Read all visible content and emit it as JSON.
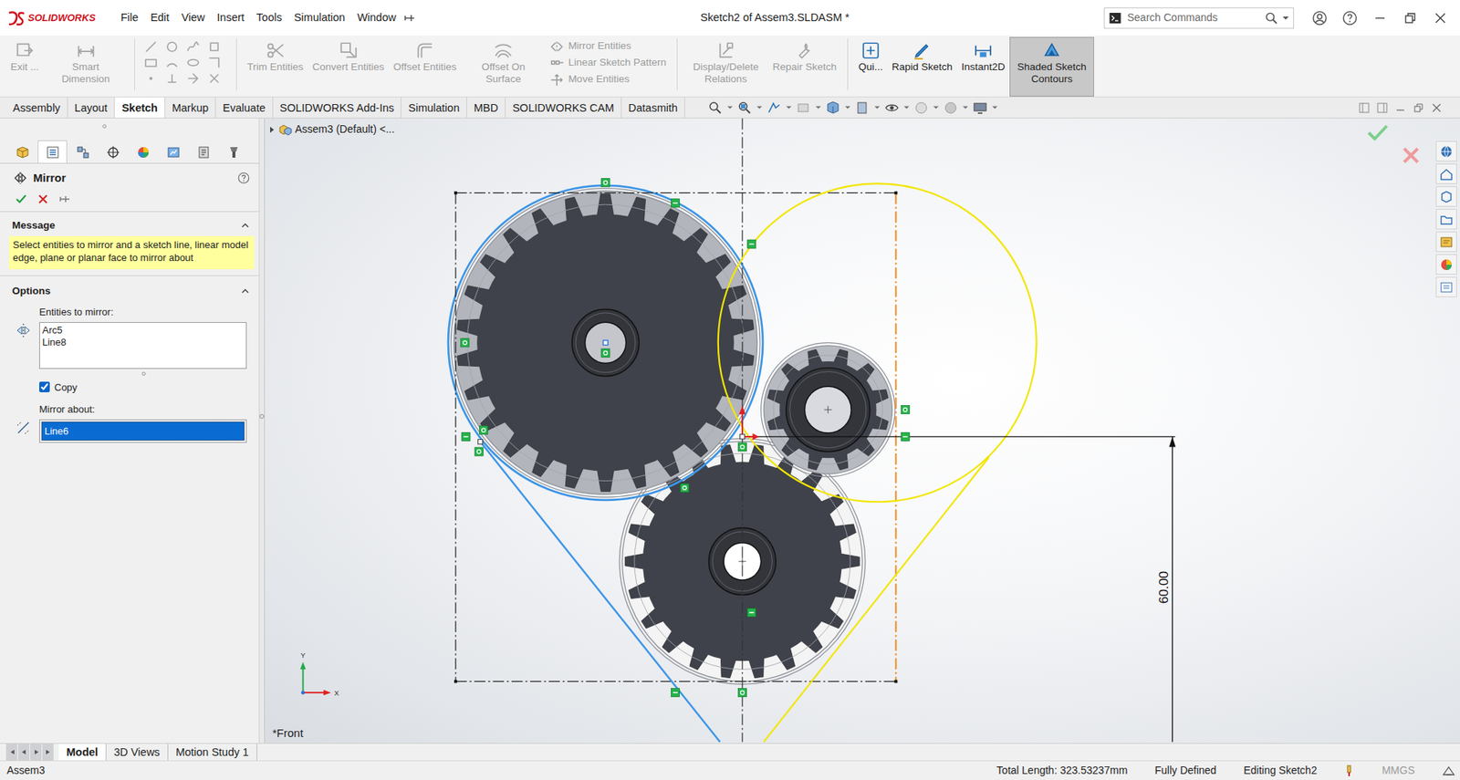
{
  "window": {
    "brand": "SOLIDWORKS",
    "title": "Sketch2 of Assem3.SLDASM *"
  },
  "menus": [
    "File",
    "Edit",
    "View",
    "Insert",
    "Tools",
    "Simulation",
    "Window"
  ],
  "search": {
    "placeholder": "Search Commands"
  },
  "ribbon": [
    {
      "kind": "large",
      "label": "Exit ...",
      "disabled": true,
      "selected": false
    },
    {
      "kind": "large",
      "label": "Smart Dimension",
      "disabled": true,
      "selected": false
    },
    {
      "kind": "tools",
      "disabled": true,
      "selected": false
    },
    {
      "kind": "large",
      "label": "Trim Entities",
      "disabled": true,
      "selected": false
    },
    {
      "kind": "large",
      "label": "Convert Entities",
      "disabled": true,
      "selected": false
    },
    {
      "kind": "large",
      "label": "Offset Entities",
      "disabled": true,
      "selected": false
    },
    {
      "kind": "large",
      "label": "Offset On Surface",
      "disabled": true,
      "selected": false
    },
    {
      "kind": "stack",
      "disabled": true,
      "selected": false,
      "items": [
        {
          "label": "Mirror Entities",
          "disabled": true
        },
        {
          "label": "Linear Sketch Pattern",
          "disabled": true
        },
        {
          "label": "Move Entities",
          "disabled": true
        }
      ]
    },
    {
      "kind": "large",
      "label": "Display/Delete Relations",
      "disabled": true,
      "selected": false
    },
    {
      "kind": "large",
      "label": "Repair Sketch",
      "disabled": true,
      "selected": false
    },
    {
      "kind": "large",
      "label": "Qui...",
      "disabled": false,
      "selected": false
    },
    {
      "kind": "large",
      "label": "Rapid Sketch",
      "disabled": false,
      "selected": false
    },
    {
      "kind": "large",
      "label": "Instant2D",
      "disabled": false,
      "selected": false
    },
    {
      "kind": "large",
      "label": "Shaded Sketch Contours",
      "disabled": false,
      "selected": true
    }
  ],
  "tabs": [
    {
      "label": "Assembly",
      "selected": false
    },
    {
      "label": "Layout",
      "selected": false
    },
    {
      "label": "Sketch",
      "selected": true
    },
    {
      "label": "Markup",
      "selected": false
    },
    {
      "label": "Evaluate",
      "selected": false
    },
    {
      "label": "SOLIDWORKS Add-Ins",
      "selected": false
    },
    {
      "label": "Simulation",
      "selected": false
    },
    {
      "label": "MBD",
      "selected": false
    },
    {
      "label": "SOLIDWORKS CAM",
      "selected": false
    },
    {
      "label": "Datasmith",
      "selected": false
    }
  ],
  "panel_tabs": [
    {
      "selected": false
    },
    {
      "selected": true
    },
    {
      "selected": false
    },
    {
      "selected": false
    },
    {
      "selected": false
    },
    {
      "selected": false
    },
    {
      "selected": false
    },
    {
      "selected": false
    }
  ],
  "property_manager": {
    "title": "Mirror",
    "message_heading": "Message",
    "message": "Select entities to mirror and a sketch line, linear model edge, plane or planar face to mirror about",
    "options_heading": "Options",
    "entities_label": "Entities to mirror:",
    "entities": [
      "Arc5",
      "Line8"
    ],
    "copy": {
      "label": "Copy",
      "checked": true
    },
    "mirror_about_label": "Mirror about:",
    "mirror_about": "Line6",
    "mirror_about_selected": true
  },
  "viewport": {
    "tree_label": "Assem3 (Default) <...",
    "view_name": "*Front",
    "dimension": "60.00",
    "axis_y": "Y",
    "axis_x": "X"
  },
  "bottom_tabs": [
    {
      "label": "Model",
      "selected": true
    },
    {
      "label": "3D Views",
      "selected": false
    },
    {
      "label": "Motion Study 1",
      "selected": false
    }
  ],
  "status_bar": {
    "document": "Assem3",
    "total_length": "Total Length: 323.53237mm",
    "state": "Fully Defined",
    "mode": "Editing Sketch2",
    "units": "MMGS",
    "units_disabled": true
  }
}
